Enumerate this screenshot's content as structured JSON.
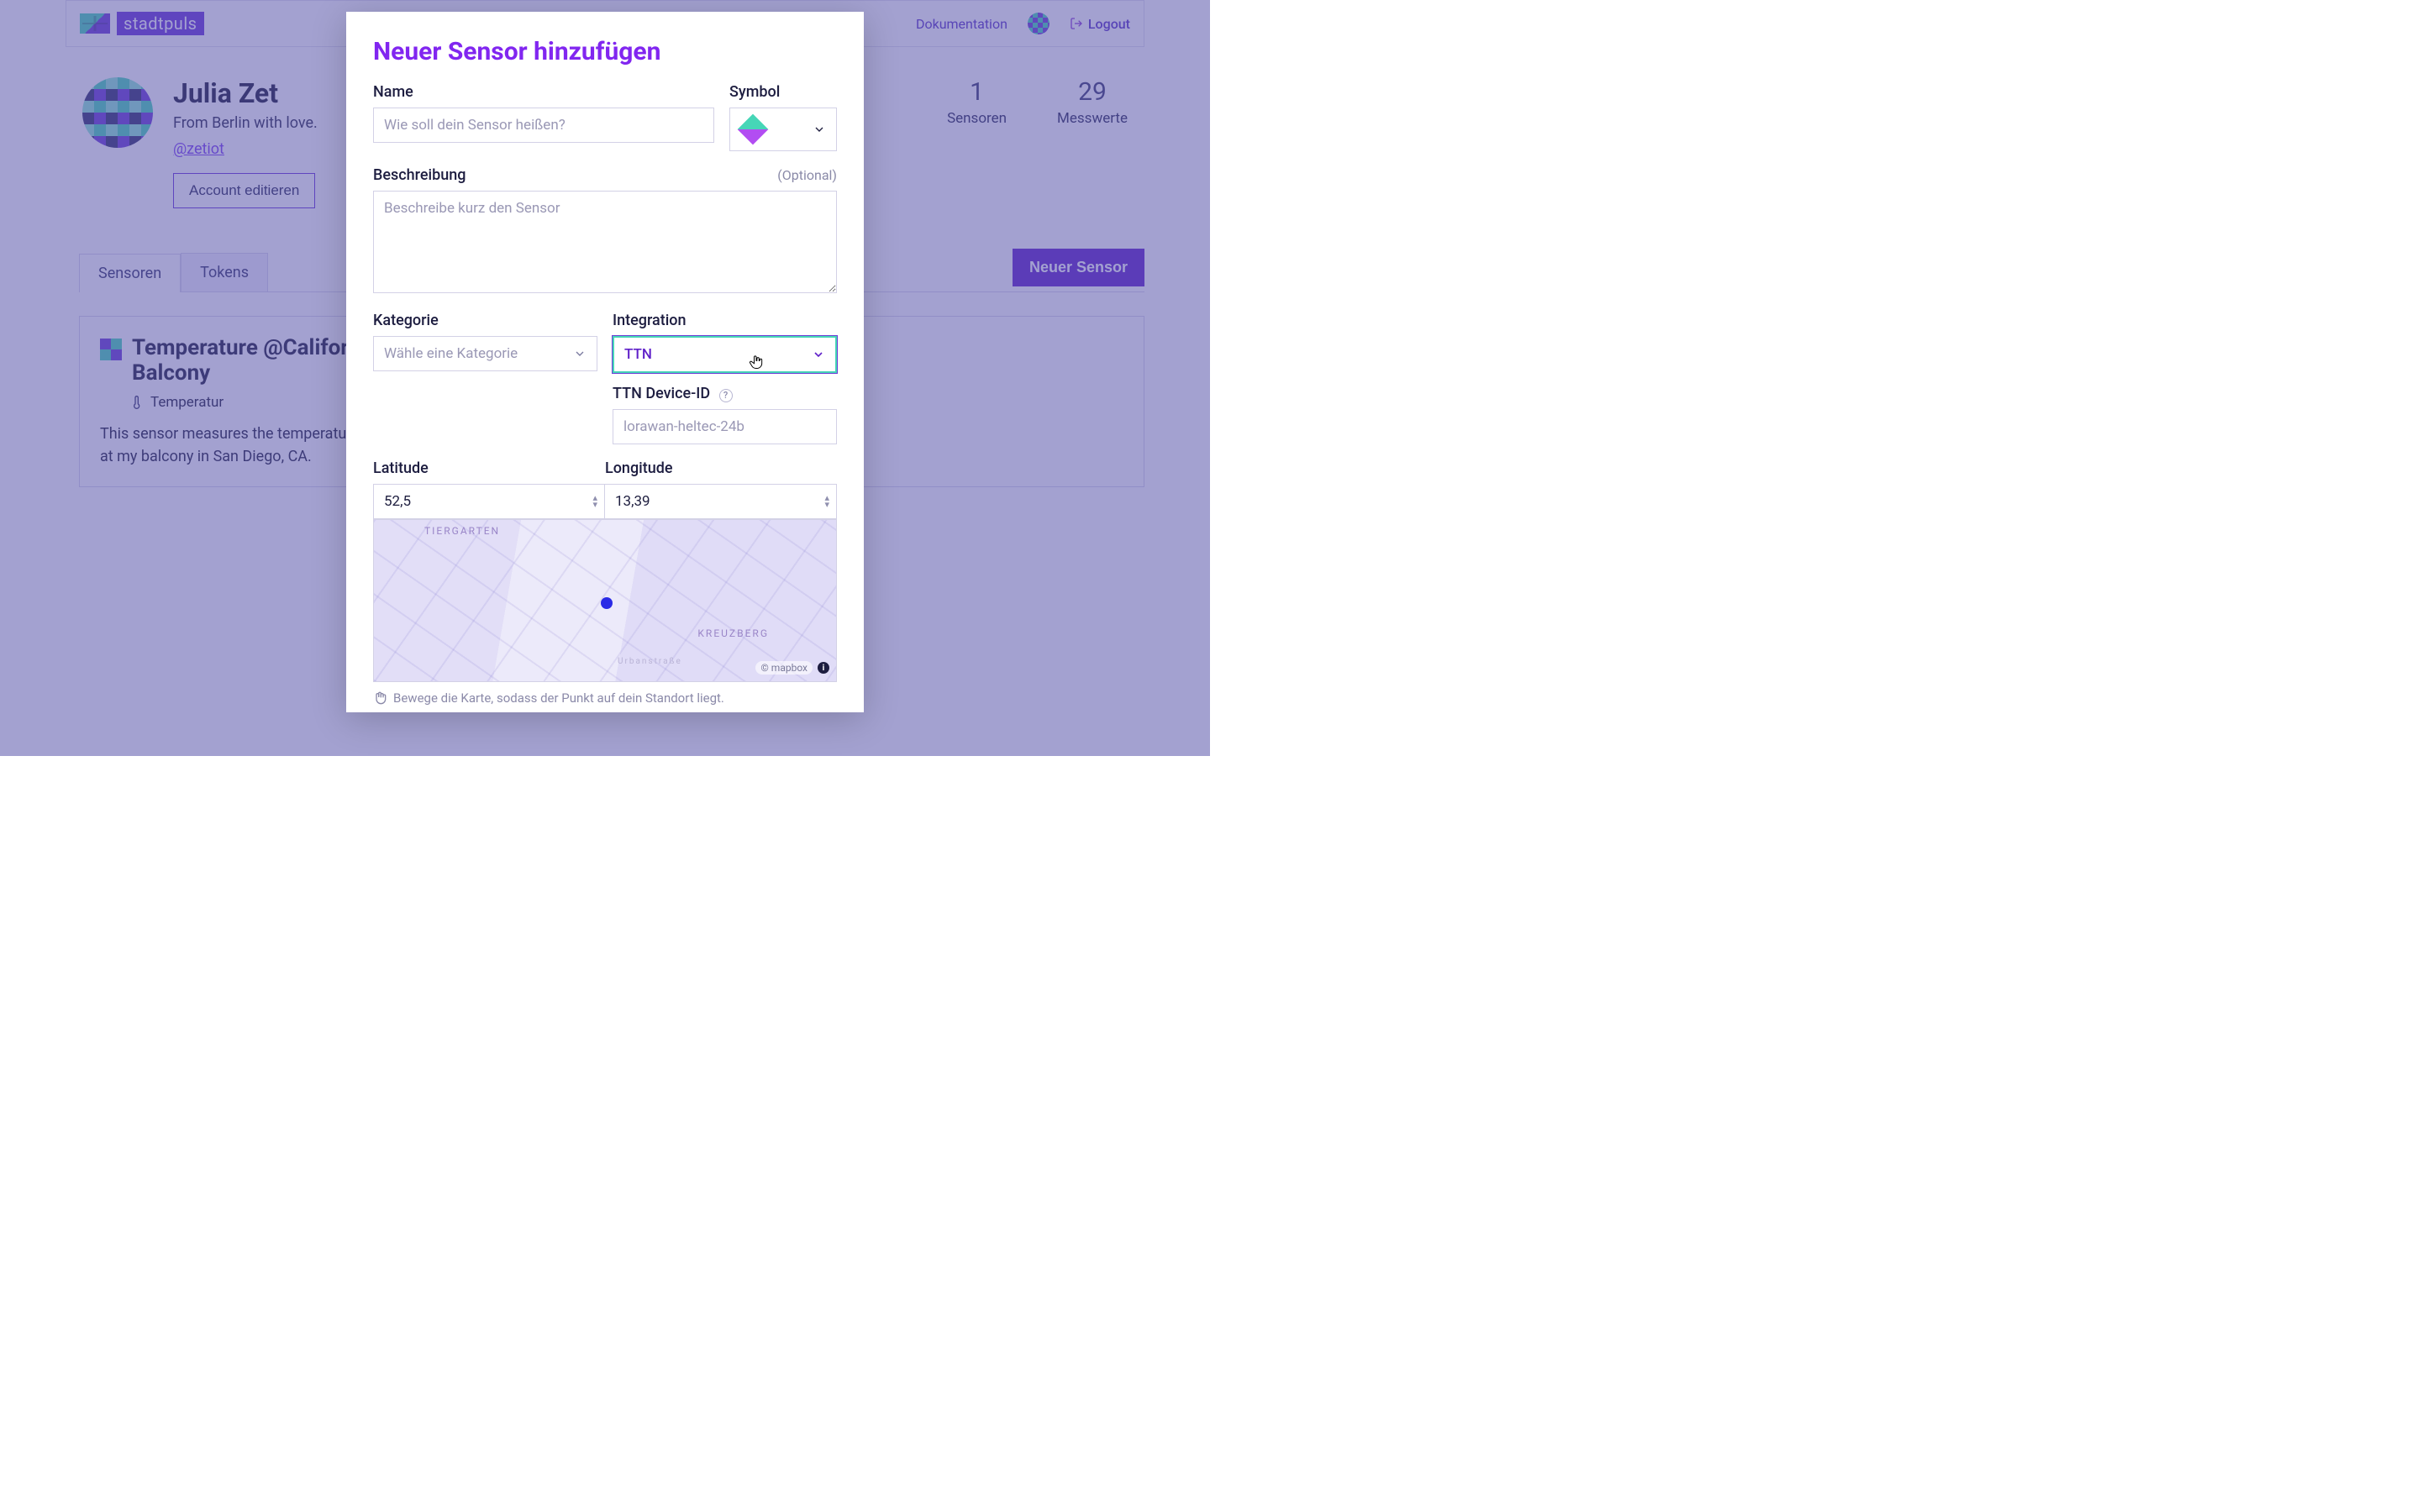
{
  "brand": {
    "name": "stadtpuls"
  },
  "nav": {
    "docs": "Dokumentation",
    "logout": "Logout"
  },
  "profile": {
    "name": "Julia Zet",
    "tagline": "From Berlin with love.",
    "handle": "@zetiot",
    "edit": "Account editieren"
  },
  "stats": {
    "sensors_count": "1",
    "sensors_label": "Sensoren",
    "readings_count": "29",
    "readings_label": "Messwerte"
  },
  "tabs": {
    "sensors": "Sensoren",
    "tokens": "Tokens"
  },
  "buttons": {
    "new_sensor": "Neuer Sensor"
  },
  "card": {
    "title_line1": "Temperature @California",
    "title_line2": "Balcony",
    "category": "Temperatur",
    "desc_line1": "This sensor measures the temperature",
    "desc_line2": "at my balcony in San Diego, CA."
  },
  "modal": {
    "title": "Neuer Sensor hinzufügen",
    "name_label": "Name",
    "name_placeholder": "Wie soll dein Sensor heißen?",
    "symbol_label": "Symbol",
    "desc_label": "Beschreibung",
    "optional": "(Optional)",
    "desc_placeholder": "Beschreibe kurz den Sensor",
    "category_label": "Kategorie",
    "category_placeholder": "Wähle eine Kategorie",
    "integration_label": "Integration",
    "integration_value": "TTN",
    "device_id_label": "TTN Device-ID",
    "device_id_placeholder": "lorawan-heltec-24b",
    "lat_label": "Latitude",
    "lat_value": "52,5",
    "lon_label": "Longitude",
    "lon_value": "13,39",
    "map_district1": "TIERGARTEN",
    "map_district2": "KREUZBERG",
    "map_street": "Urbanstraße",
    "map_attrib": "mapbox",
    "hint": "Bewege die Karte, sodass der Punkt auf dein Standort liegt."
  }
}
